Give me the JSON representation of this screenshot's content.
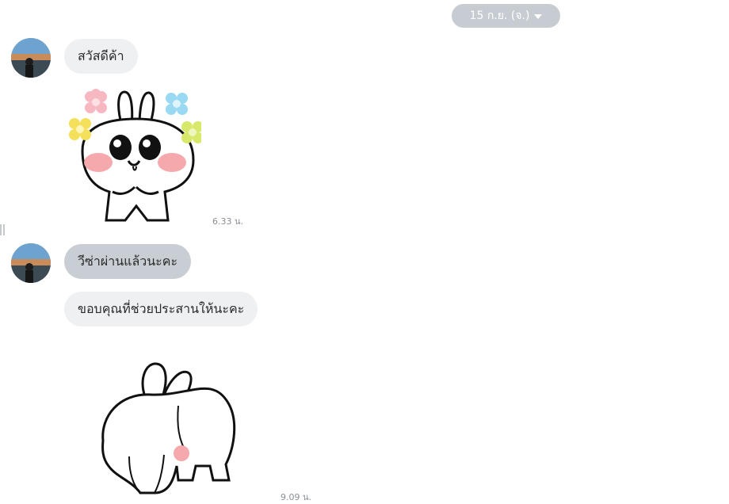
{
  "header": {
    "date_label": "15 ก.ย. (จ.)"
  },
  "messages": [
    {
      "text": "สวัสดีค้า"
    },
    {
      "time": "6.33 น."
    },
    {
      "text": "วีซ่าผ่านแล้วนะคะ"
    },
    {
      "text": "ขอบคุณที่ช่วยประสานให้นะคะ"
    },
    {
      "time": "9.09 น."
    }
  ],
  "colors": {
    "bubble_light": "#eef0f2",
    "bubble_gray": "#c9ced4",
    "date_pill": "#c7ccd3",
    "time_text": "#8a8f96"
  },
  "icons": [
    "chevron-down-icon",
    "bunny-flowers-sticker",
    "bunny-bowing-sticker"
  ]
}
